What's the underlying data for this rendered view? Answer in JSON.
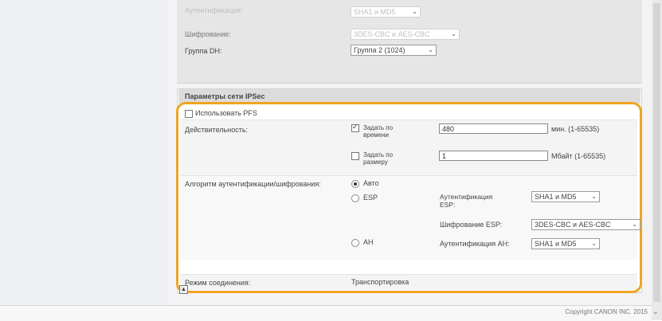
{
  "top": {
    "auth_label": "Аутентификация:",
    "auth_value": "SHA1 и MD5",
    "encryption_label": "Шифрование:",
    "encryption_value": "3DES-CBC и AES-CBC",
    "dh_label": "Группа DH:",
    "dh_value": "Группа 2 (1024)"
  },
  "ipsec": {
    "header": "Параметры сети IPSec",
    "use_pfs_label": "Использовать PFS",
    "use_pfs_checked": false,
    "validity_label": "Действительность:",
    "set_by_time_label": "Задать по времени",
    "set_by_time_checked": true,
    "time_value": "480",
    "time_unit": "мин. (1-65535)",
    "set_by_size_label": "Задать по размеру",
    "set_by_size_checked": false,
    "size_value": "1",
    "size_unit": "Мбайт (1-65535)",
    "algo_label": "Алгоритм аутентификации/шифрования:",
    "auto_label": "Авто",
    "esp_label": "ESP",
    "esp_auth_label": "Аутентификация ESP:",
    "esp_auth_value": "SHA1 и MD5",
    "esp_enc_label": "Шифрование ESP:",
    "esp_enc_value": "3DES-CBC и AES-CBC",
    "ah_label": "AH",
    "ah_auth_label": "Аутентификация AH:",
    "ah_auth_value": "SHA1 и MD5",
    "mode_label": "Режим соединения:",
    "mode_value": "Транспортировка",
    "selected_algorithm": "Авто"
  },
  "footer": {
    "copyright": "Copyright CANON INC. 2015"
  },
  "icons": {
    "expand": "expand-icon",
    "chevron": "chevron-down-icon",
    "scroll": "scroll-arrow-icon"
  }
}
